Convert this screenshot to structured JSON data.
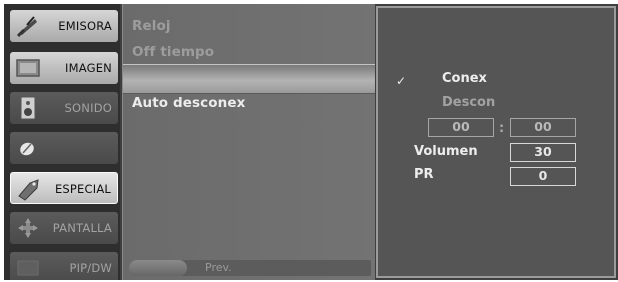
{
  "sidebar": {
    "items": [
      {
        "label": "EMISORA",
        "icon": "satellite-dish-icon"
      },
      {
        "label": "IMAGEN",
        "icon": "picture-icon"
      },
      {
        "label": "SONIDO",
        "icon": "speaker-icon"
      },
      {
        "label": "",
        "icon": "ball-icon"
      },
      {
        "label": "ESPECIAL",
        "icon": "tag-icon"
      },
      {
        "label": "PANTALLA",
        "icon": "move-arrows-icon"
      },
      {
        "label": "PIP/DW",
        "icon": "pip-icon"
      }
    ],
    "active_index": 4
  },
  "menu": {
    "items": [
      "Reloj",
      "Off tiempo",
      "Auto desconex"
    ],
    "highlight_index": 1
  },
  "footer": {
    "prev_label": "Prev."
  },
  "options": {
    "check_mark": "✓",
    "conex": "Conex",
    "descon": "Descon",
    "time_hour": "00",
    "time_separator": ":",
    "time_minute": "00",
    "volumen_label": "Volumen",
    "volumen_value": "30",
    "pr_label": "PR",
    "pr_value": "0"
  }
}
